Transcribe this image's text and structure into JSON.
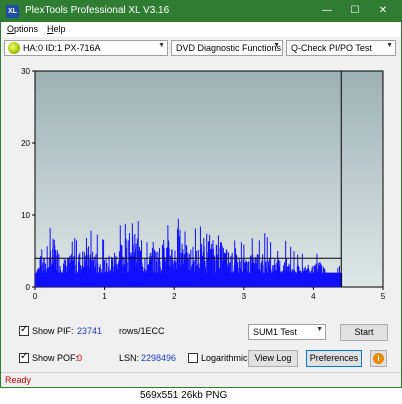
{
  "titlebar": {
    "icon_text": "XL",
    "title": "PlexTools Professional XL V3.16",
    "minimize": "—",
    "maximize": "☐",
    "close": "✕"
  },
  "menu": {
    "items": [
      {
        "label": "Options",
        "underline": "O",
        "rest": "ptions"
      },
      {
        "label": "Help",
        "underline": "H",
        "rest": "elp"
      }
    ]
  },
  "toolbar": {
    "drive": "HA:0 ID:1  PX-716A",
    "function": "DVD Diagnostic Functions",
    "test": "Q-Check PI/PO Test"
  },
  "chart_data": {
    "type": "bar",
    "title": "",
    "xlabel": "",
    "ylabel": "",
    "xlim": [
      0,
      5
    ],
    "ylim": [
      0,
      30
    ],
    "x_ticks": [
      "0",
      "1",
      "2",
      "3",
      "4",
      "5"
    ],
    "y_ticks": [
      "0",
      "10",
      "20",
      "30"
    ],
    "data_end_x": 4.4,
    "threshold_y": 4,
    "series": [
      {
        "style": "dense blue bars (PI errors)",
        "x": [
          0.0,
          0.2,
          0.25,
          0.4,
          0.6,
          0.8,
          0.95,
          1.0,
          1.2,
          1.4,
          1.6,
          1.8,
          1.95,
          2.0,
          2.05,
          2.2,
          2.4,
          2.6,
          2.8,
          3.0,
          3.2,
          3.4,
          3.6,
          3.8,
          4.0,
          4.1,
          4.2,
          4.35
        ],
        "values": [
          3,
          5,
          7,
          4,
          5,
          6,
          4,
          4,
          6,
          8,
          5,
          6,
          7,
          6,
          9,
          5,
          6,
          7,
          5,
          4,
          5,
          4,
          4,
          3,
          3,
          4,
          2,
          2
        ]
      },
      {
        "style": "baseline PI level",
        "x": [
          0,
          4.4
        ],
        "values": [
          2,
          2
        ]
      }
    ],
    "colors": {
      "bar": "#1010ff",
      "background_top": "#9cb1b3",
      "background_bottom": "#dfe7e7",
      "threshold": "#000000"
    }
  },
  "bottom": {
    "show_pif_label": "Show PIF:",
    "pif_value": "23741",
    "pif_units": "rows/1ECC",
    "show_pof_label": "Show POF:",
    "pof_value": "0",
    "lsn_label": "LSN:",
    "lsn_value": "2298496",
    "log_label": "Logarithmic",
    "sum_select": "SUM1 Test",
    "start_button": "Start",
    "viewlog_button": "View Log",
    "prefs_button": "Preferences",
    "info_icon": "i"
  },
  "status": {
    "text": "Ready"
  },
  "caption": {
    "text": "569x551  26kb  PNG"
  }
}
